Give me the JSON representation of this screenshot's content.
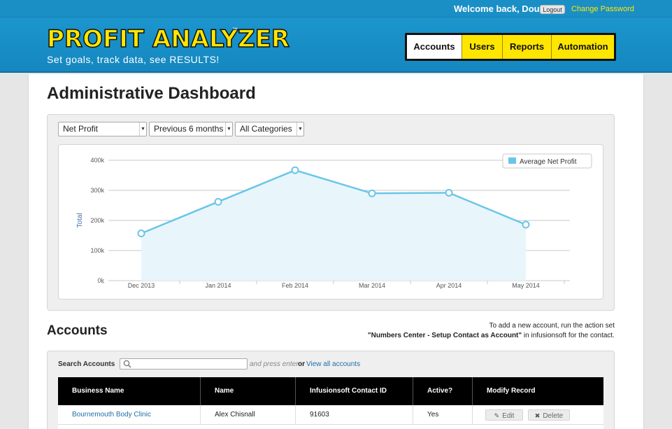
{
  "header": {
    "welcome": "Welcome back, Doug",
    "logout_label": "Logout",
    "change_password_label": "Change Password",
    "logo_title": "PROFIT ANALYZER",
    "logo_tm": "™",
    "tagline": "Set goals, track data, see RESULTS!",
    "nav": [
      {
        "label": "Accounts",
        "active": true
      },
      {
        "label": "Users",
        "active": false
      },
      {
        "label": "Reports",
        "active": false
      },
      {
        "label": "Automation",
        "active": false
      }
    ]
  },
  "page_title": "Administrative Dashboard",
  "filters": {
    "metric": "Net Profit",
    "period": "Previous 6 months",
    "category": "All Categories"
  },
  "chart_data": {
    "type": "area",
    "categories": [
      "Dec 2013",
      "Jan 2014",
      "Feb 2014",
      "Mar 2014",
      "Apr 2014",
      "May 2014"
    ],
    "series": [
      {
        "name": "Average Net Profit",
        "values": [
          157000,
          262000,
          367000,
          290000,
          292000,
          186000
        ]
      }
    ],
    "ylabel": "Total",
    "ylim": [
      0,
      400000
    ],
    "yticks": [
      {
        "value": 0,
        "label": "0k"
      },
      {
        "value": 100000,
        "label": "100k"
      },
      {
        "value": 200000,
        "label": "200k"
      },
      {
        "value": 300000,
        "label": "300k"
      },
      {
        "value": 400000,
        "label": "400k"
      }
    ],
    "grid": true,
    "legend": "top-right",
    "colors": {
      "line": "#6cc5e8",
      "fill": "#e8f6fc",
      "grid": "#c9c9c9"
    }
  },
  "accounts": {
    "title": "Accounts",
    "note_line1": "To add a new account, run the action set",
    "note_bold": "\"Numbers Center - Setup Contact as Account\"",
    "note_line2_rest": " in infusionsoft for the contact.",
    "search_label": "Search Accounts",
    "search_value": "",
    "press_enter": "and press enter",
    "or_text": "or",
    "view_all": "View all accounts",
    "columns": [
      "Business Name",
      "Name",
      "Infusionsoft Contact ID",
      "Active?",
      "Modify Record"
    ],
    "rows": [
      {
        "business": "Bournemouth Body Clinic",
        "name": "Alex Chisnall",
        "contact_id": "91603",
        "active": "Yes",
        "edit": "Edit",
        "delete": "Delete"
      }
    ]
  }
}
